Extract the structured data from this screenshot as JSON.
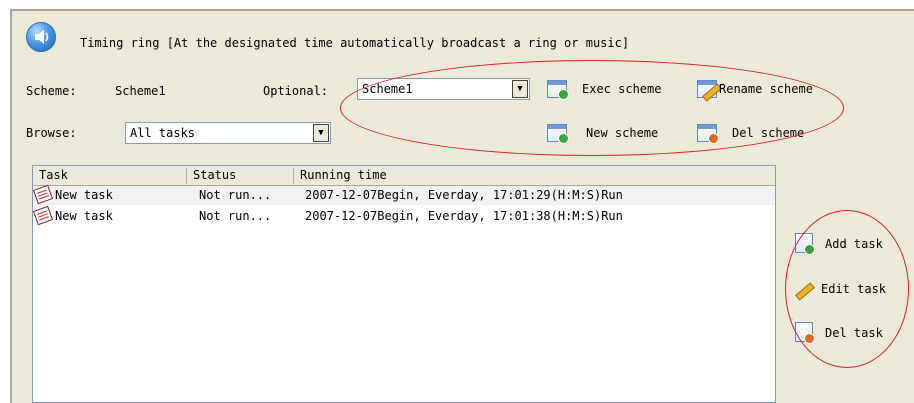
{
  "header": {
    "title": "Timing ring [At the designated time automatically broadcast a ring or music]"
  },
  "scheme": {
    "label": "Scheme:",
    "value": "Scheme1"
  },
  "optional": {
    "label": "Optional:",
    "selected": "Scheme1"
  },
  "browse": {
    "label": "Browse:",
    "selected": "All tasks"
  },
  "scheme_buttons": {
    "exec": "Exec scheme",
    "rename": "Rename scheme",
    "new": "New scheme",
    "del": "Del scheme"
  },
  "table": {
    "columns": [
      "Task",
      "Status",
      "Running time"
    ],
    "rows": [
      {
        "task": "New task",
        "status": "Not run...",
        "time": "2007-12-07Begin, Everday, 17:01:29(H:M:S)Run"
      },
      {
        "task": "New task",
        "status": "Not run...",
        "time": "2007-12-07Begin, Everday, 17:01:38(H:M:S)Run"
      }
    ]
  },
  "task_buttons": {
    "add": "Add task",
    "edit": "Edit task",
    "del": "Del task"
  },
  "icons": [
    "speaker-icon",
    "exec-scheme-icon",
    "rename-scheme-icon",
    "new-scheme-icon",
    "del-scheme-icon",
    "task-icon",
    "add-task-icon",
    "edit-task-icon",
    "del-task-icon"
  ],
  "colors": {
    "annotation": "#e02020",
    "panel": "#ece9d8",
    "accent": "#4a98e6"
  }
}
